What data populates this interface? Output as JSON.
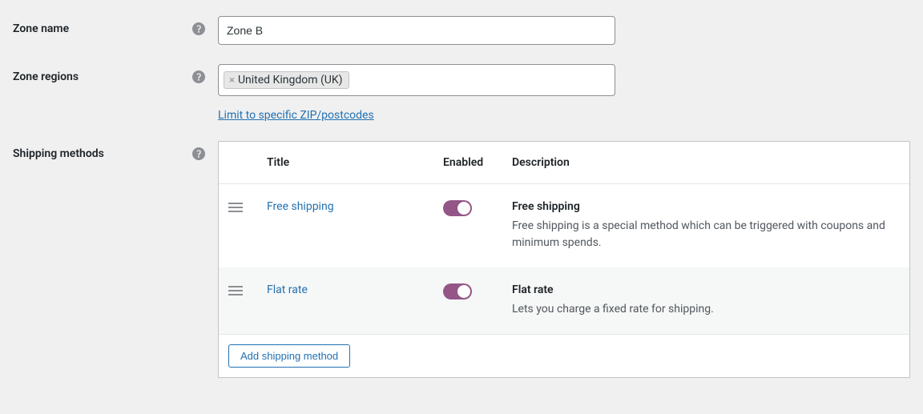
{
  "zone_name": {
    "label": "Zone name",
    "value": "Zone B"
  },
  "zone_regions": {
    "label": "Zone regions",
    "tags": [
      "United Kingdom (UK)"
    ],
    "limit_link": "Limit to specific ZIP/postcodes"
  },
  "shipping_methods": {
    "label": "Shipping methods",
    "headers": {
      "title": "Title",
      "enabled": "Enabled",
      "description": "Description"
    },
    "rows": [
      {
        "title": "Free shipping",
        "enabled": true,
        "desc_title": "Free shipping",
        "desc_text": "Free shipping is a special method which can be triggered with coupons and minimum spends."
      },
      {
        "title": "Flat rate",
        "enabled": true,
        "desc_title": "Flat rate",
        "desc_text": "Lets you charge a fixed rate for shipping."
      }
    ],
    "add_button": "Add shipping method"
  }
}
